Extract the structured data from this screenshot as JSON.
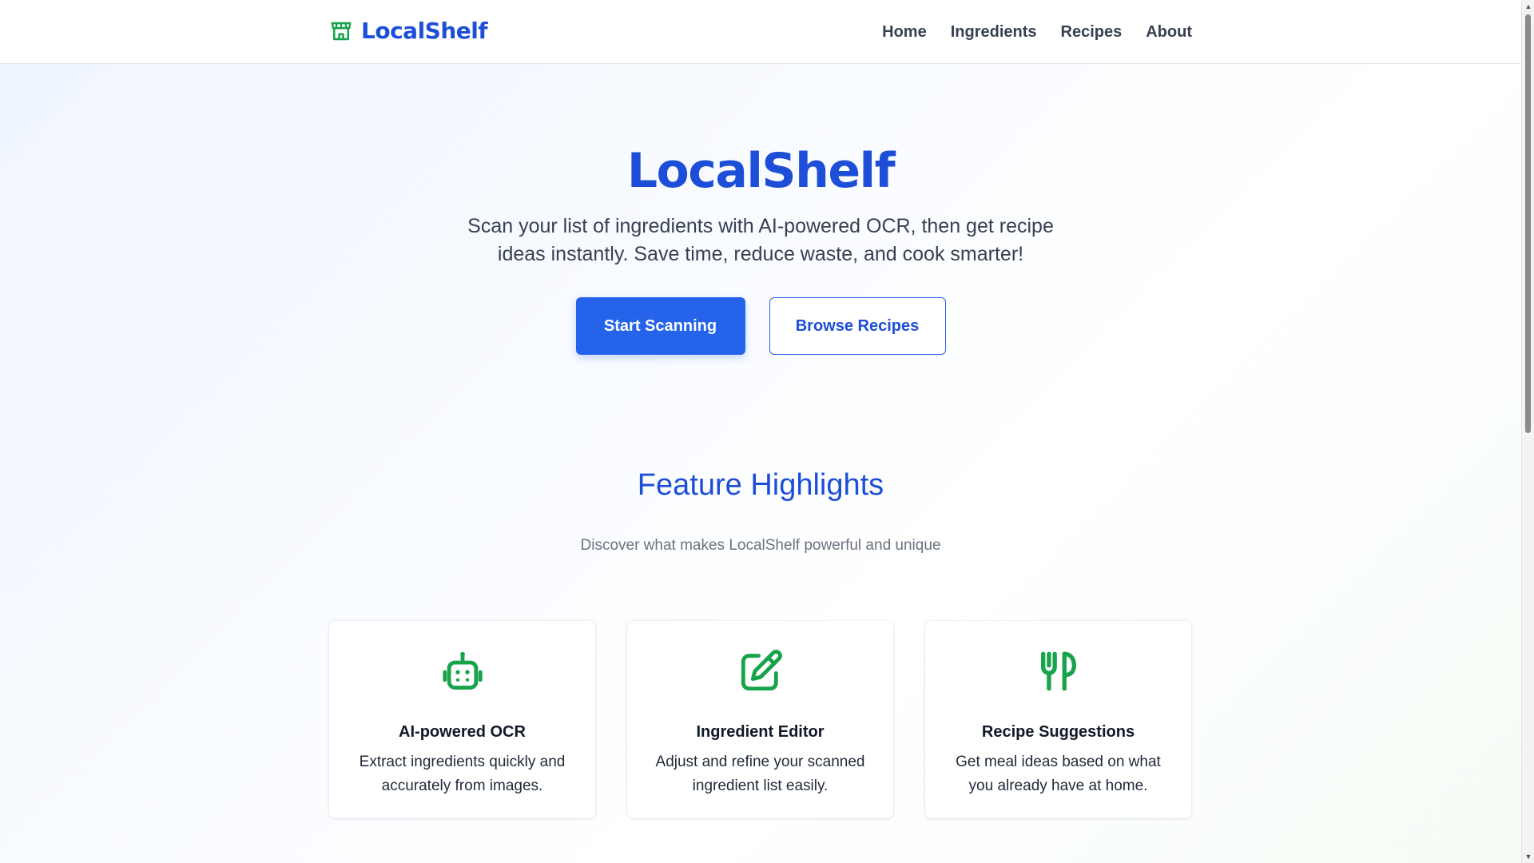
{
  "colors": {
    "brand_blue": "#1d4ed8",
    "primary_button": "#2563eb",
    "icon_green": "#16a34a",
    "nav_text": "#374151",
    "muted_text": "#6b7280"
  },
  "header": {
    "brand": {
      "icon": "store-icon",
      "name": "LocalShelf"
    },
    "nav": [
      {
        "label": "Home"
      },
      {
        "label": "Ingredients"
      },
      {
        "label": "Recipes"
      },
      {
        "label": "About"
      }
    ]
  },
  "hero": {
    "title": "LocalShelf",
    "subtitle": "Scan your list of ingredients with AI-powered OCR, then get recipe ideas instantly. Save time, reduce waste, and cook smarter!",
    "primary_button": "Start Scanning",
    "secondary_button": "Browse Recipes"
  },
  "features": {
    "title": "Feature Highlights",
    "subtitle": "Discover what makes LocalShelf powerful and unique",
    "cards": [
      {
        "icon": "robot-icon",
        "title": "AI-powered OCR",
        "description": "Extract ingredients quickly and accurately from images."
      },
      {
        "icon": "edit-icon",
        "title": "Ingredient Editor",
        "description": "Adjust and refine your scanned ingredient list easily."
      },
      {
        "icon": "utensils-icon",
        "title": "Recipe Suggestions",
        "description": "Get meal ideas based on what you already have at home."
      }
    ]
  }
}
